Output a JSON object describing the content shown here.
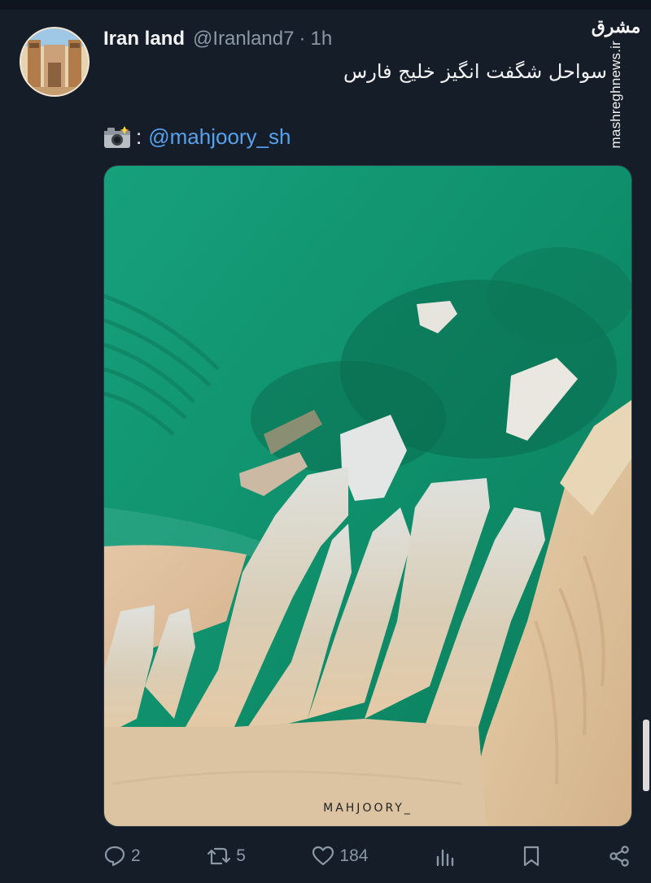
{
  "tweet": {
    "author_name": "Iran land",
    "author_handle": "@Iranland7",
    "separator": "·",
    "time": "1h",
    "text": "سواحل شگفت انگیز خلیج فارس",
    "credit_colon": ":",
    "credit_mention": "@mahjoory_sh"
  },
  "watermark": {
    "logo": "مشرق",
    "site": "mashreghnews.ir"
  },
  "media": {
    "photo_credit": "MAHJOORY_"
  },
  "actions": {
    "replies": "2",
    "reposts": "5",
    "likes": "184"
  },
  "icons": [
    "camera-icon",
    "reply-icon",
    "repost-icon",
    "like-icon",
    "views-icon",
    "bookmark-icon",
    "share-icon"
  ],
  "colors": {
    "background": "#151d28",
    "link": "#57a2ef",
    "muted": "#8b98a5",
    "sea": "#11936f",
    "rock": "#d9d0be"
  }
}
